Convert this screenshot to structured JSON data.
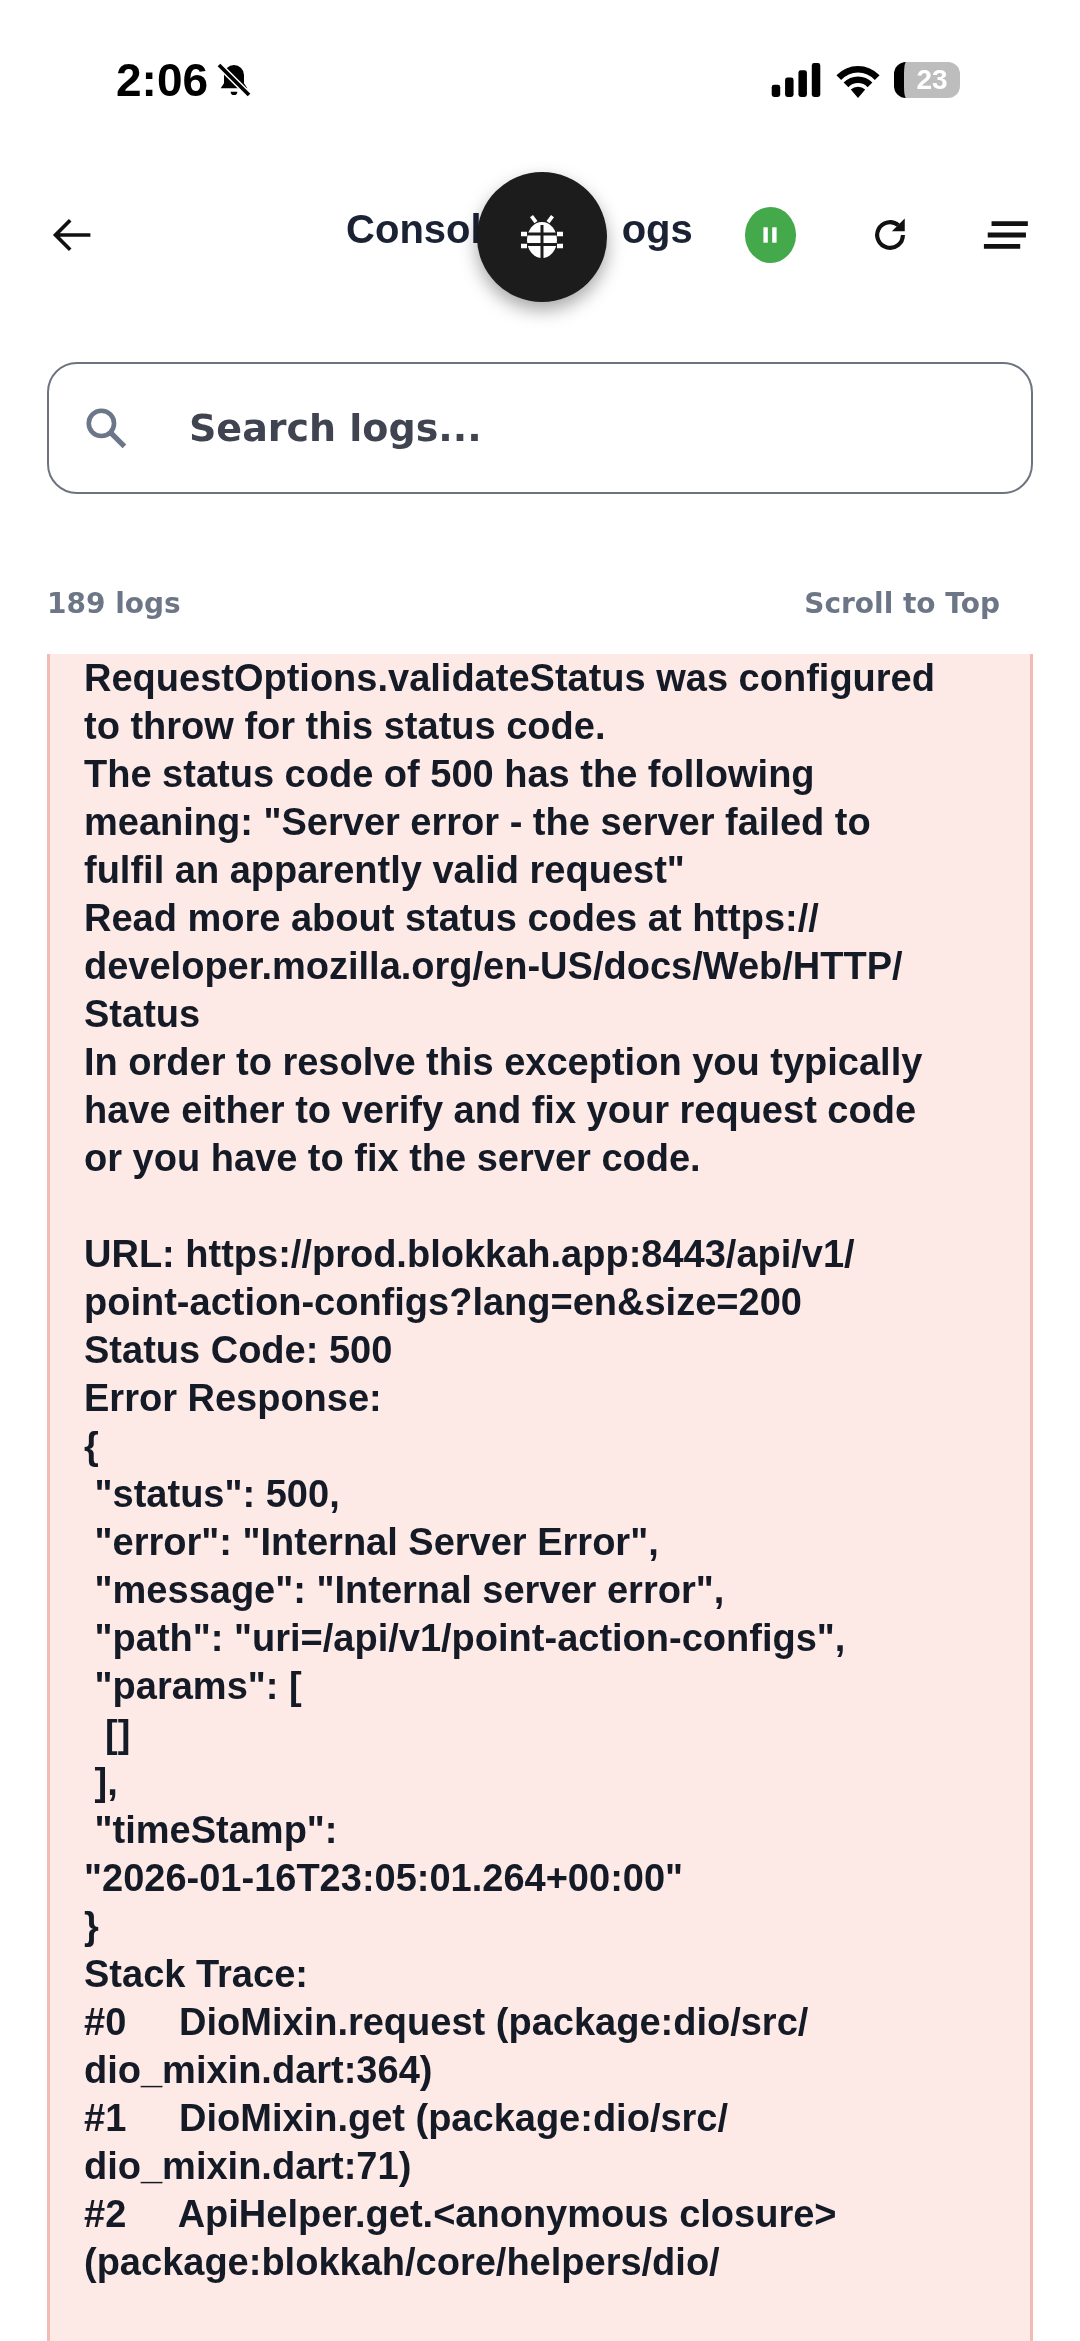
{
  "status_bar": {
    "time": "2:06",
    "silent": true,
    "battery": "23"
  },
  "header": {
    "title_left": "Consol",
    "title_right": "ogs",
    "paused": false
  },
  "search": {
    "placeholder": "Search logs..."
  },
  "summary": {
    "count": "189 logs",
    "scroll_link": "Scroll to Top"
  },
  "log_entry": {
    "blocks": [
      [
        "RequestOptions.validateStatus was configured",
        "to throw for this status code.",
        "The status code of 500 has the following",
        "meaning: \"Server error - the server failed to",
        "fulfil an apparently valid request\"",
        "Read more about status codes at https://",
        "developer.mozilla.org/en-US/docs/Web/HTTP/",
        "Status",
        "In order to resolve this exception you typically",
        "have either to verify and fix your request code",
        "or you have to fix the server code."
      ],
      [
        "URL: https://prod.blokkah.app:8443/api/v1/",
        "point-action-configs?lang=en&size=200",
        "Status Code: 500",
        "Error Response:",
        "{",
        " \"status\": 500,",
        " \"error\": \"Internal Server Error\",",
        " \"message\": \"Internal server error\",",
        " \"path\": \"uri=/api/v1/point-action-configs\",",
        " \"params\": [",
        "  []",
        " ],",
        " \"timeStamp\":",
        "\"2026-01-16T23:05:01.264+00:00\"",
        "}",
        "Stack Trace:",
        "#0     DioMixin.request (package:dio/src/",
        "dio_mixin.dart:364)",
        "#1     DioMixin.get (package:dio/src/",
        "dio_mixin.dart:71)",
        "#2     ApiHelper.get.<anonymous closure>",
        "(package:blokkah/core/helpers/dio/"
      ]
    ]
  }
}
